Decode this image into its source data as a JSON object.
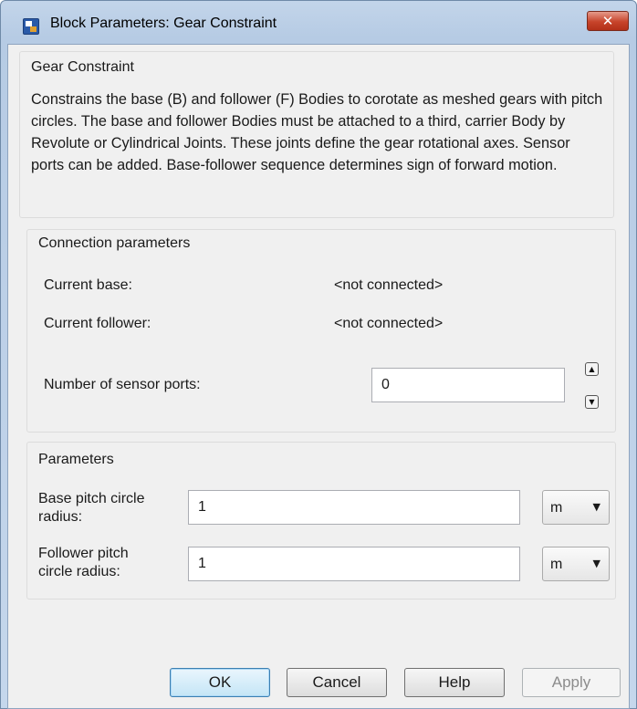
{
  "window": {
    "title": "Block Parameters: Gear Constraint",
    "close_glyph": "✕",
    "icon": "simulink-block-icon"
  },
  "description_section": {
    "title": "Gear Constraint",
    "text": "Constrains the base (B) and follower (F) Bodies to corotate as meshed gears with pitch circles. The base and follower Bodies must be attached to a third, carrier Body by Revolute or Cylindrical Joints. These joints define the gear rotational axes. Sensor ports can be added. Base-follower sequence determines sign of forward motion."
  },
  "connection_section": {
    "title": "Connection parameters",
    "current_base_label": "Current base:",
    "current_base_value": "<not connected>",
    "current_follower_label": "Current follower:",
    "current_follower_value": "<not connected>",
    "sensor_ports_label": "Number of sensor ports:",
    "sensor_ports_value": "0"
  },
  "parameters_section": {
    "title": "Parameters",
    "base_radius_label_1": "Base pitch circle",
    "base_radius_label_2": "radius:",
    "base_radius_value": "1",
    "base_radius_unit": "m",
    "follower_radius_label_1": "Follower pitch",
    "follower_radius_label_2": "circle radius:",
    "follower_radius_value": "1",
    "follower_radius_unit": "m"
  },
  "buttons": {
    "ok": "OK",
    "cancel": "Cancel",
    "help": "Help",
    "apply": "Apply"
  }
}
